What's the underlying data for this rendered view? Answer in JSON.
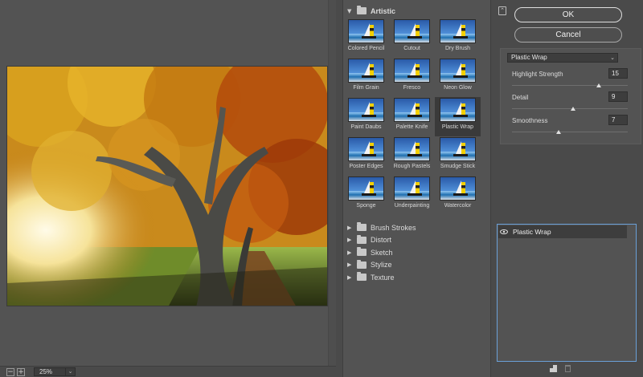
{
  "preview": {
    "zoom_minus": "−",
    "zoom_plus": "+",
    "zoom_value": "25%",
    "image_icon": "autumn-tree-photo"
  },
  "gallery": {
    "open_category": "Artistic",
    "filters": [
      {
        "label": "Colored Pencil"
      },
      {
        "label": "Cutout"
      },
      {
        "label": "Dry Brush"
      },
      {
        "label": "Film Grain"
      },
      {
        "label": "Fresco"
      },
      {
        "label": "Neon Glow"
      },
      {
        "label": "Paint Daubs"
      },
      {
        "label": "Palette Knife"
      },
      {
        "label": "Plastic Wrap"
      },
      {
        "label": "Poster Edges"
      },
      {
        "label": "Rough Pastels"
      },
      {
        "label": "Smudge Stick"
      },
      {
        "label": "Sponge"
      },
      {
        "label": "Underpainting"
      },
      {
        "label": "Watercolor"
      }
    ],
    "selected_filter": "Plastic Wrap",
    "categories": [
      "Brush Strokes",
      "Distort",
      "Sketch",
      "Stylize",
      "Texture"
    ]
  },
  "buttons": {
    "ok": "OK",
    "cancel": "Cancel"
  },
  "settings": {
    "filter_select": "Plastic Wrap",
    "params": [
      {
        "label": "Highlight Strength",
        "value": "15",
        "level": 0.75
      },
      {
        "label": "Detail",
        "value": "9",
        "level": 0.53
      },
      {
        "label": "Smoothness",
        "value": "7",
        "level": 0.4
      }
    ]
  },
  "layers": {
    "items": [
      {
        "name": "Plastic Wrap",
        "visible": true
      }
    ]
  },
  "colors": {
    "panel": "#535353",
    "background": "#4a4a4a",
    "accent_border": "#6aa0d8"
  }
}
